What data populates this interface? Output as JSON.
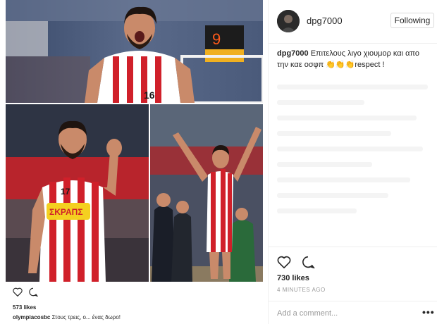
{
  "post": {
    "username": "dpg7000",
    "follow_label": "Following",
    "caption_user": "dpg7000",
    "caption_text": "Επιτελους λιγο χιουμορ και απο την καε οσφπ 👏👏👏respect !",
    "likes": "730 likes",
    "timestamp": "4 MINUTES AGO",
    "comment_placeholder": "Add a comment...",
    "more_label": "•••"
  },
  "collage": {
    "scoreboard_text": "9",
    "jersey_top_number": "16",
    "jersey_left_number": "17",
    "sponsor_text": "ΣΚΡΑΠΣ",
    "caption_overlay": {
      "likes": "573 likes",
      "user": "olympiacosbc",
      "text": "Στους τρεις, ο... ένας δωρο!"
    }
  },
  "icons": {
    "like": "heart-icon",
    "comment": "comment-icon",
    "more": "more-options-icon"
  },
  "colors": {
    "jersey_red": "#d0202a",
    "text_dark": "#262626",
    "text_muted": "#999999",
    "border": "#dbdbdb"
  }
}
